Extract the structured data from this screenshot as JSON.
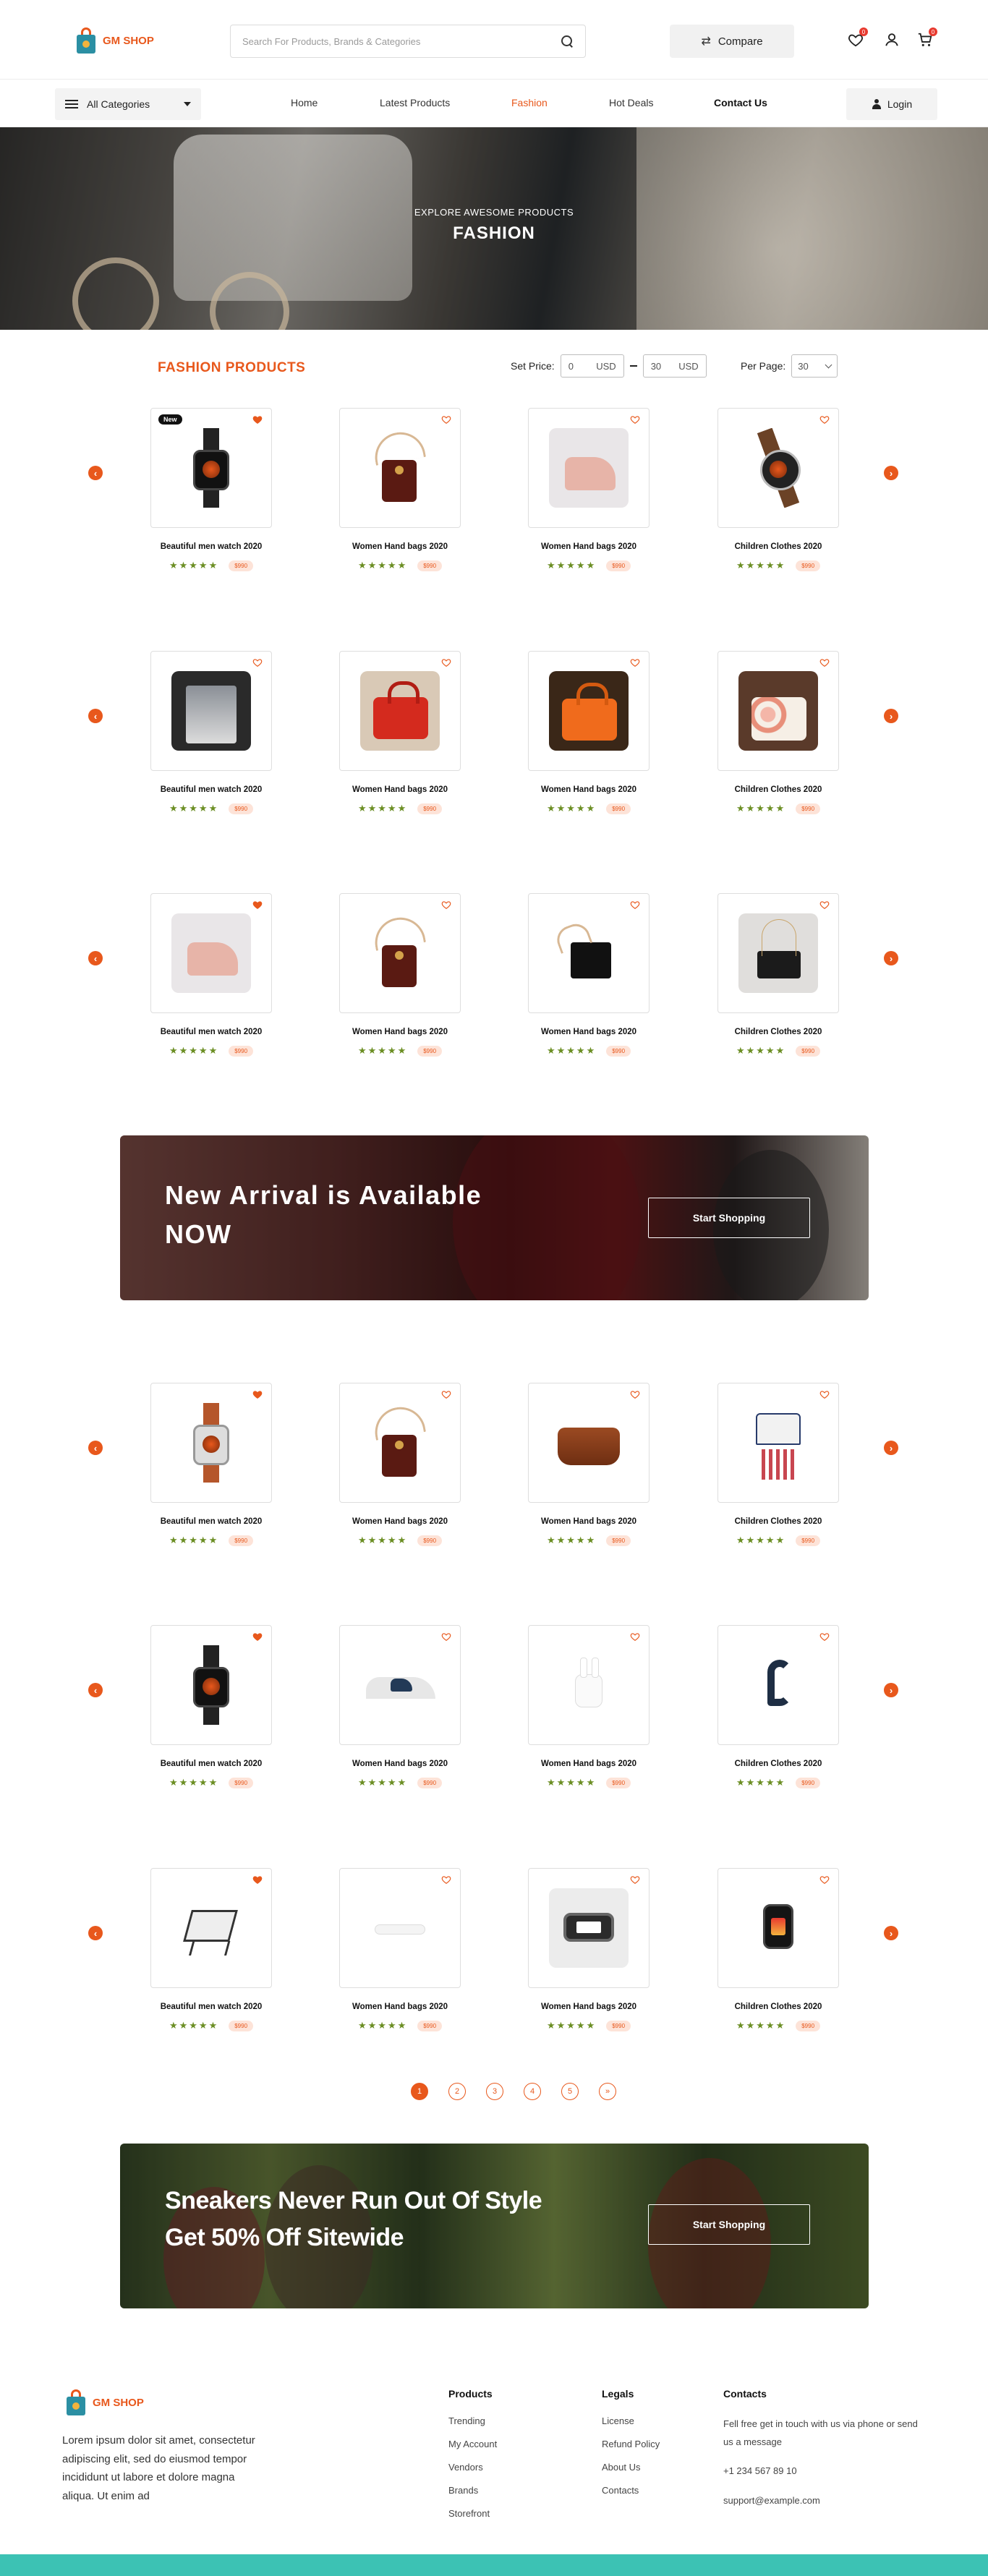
{
  "brand": {
    "name": "GM SHOP",
    "accent": "#e8581c"
  },
  "header": {
    "search_placeholder": "Search For Products, Brands & Categories",
    "compare_label": "Compare",
    "wishlist_badge": "0",
    "cart_badge": "0"
  },
  "nav": {
    "category_label": "All Categories",
    "links": [
      "Home",
      "Latest Products",
      "Fashion",
      "Hot Deals",
      "Contact Us"
    ],
    "active": "Fashion",
    "login_label": "Login"
  },
  "hero": {
    "kicker": "EXPLORE AWESOME PRODUCTS",
    "title": "FASHION"
  },
  "products_section": {
    "title": "FASHION PRODUCTS",
    "price_label": "Set Price:",
    "price_min": "0",
    "price_max": "30",
    "currency": "USD",
    "per_page_label": "Per Page:",
    "per_page_value": "30"
  },
  "product_rows": [
    [
      {
        "name": "Beautiful men watch 2020",
        "price": "$990",
        "img": "watch",
        "new": "New",
        "fav": true
      },
      {
        "name": "Women Hand bags 2020",
        "price": "$990",
        "img": "sling",
        "fav": false
      },
      {
        "name": "Women Hand bags 2020",
        "price": "$990",
        "img": "pink",
        "fav": false
      },
      {
        "name": "Children Clothes 2020",
        "price": "$990",
        "img": "watch round",
        "fav": false
      }
    ],
    [
      {
        "name": "Beautiful men watch 2020",
        "price": "$990",
        "img": "dark",
        "fav": false
      },
      {
        "name": "Women Hand bags 2020",
        "price": "$990",
        "img": "red",
        "fav": false
      },
      {
        "name": "Women Hand bags 2020",
        "price": "$990",
        "img": "orange",
        "fav": false
      },
      {
        "name": "Children Clothes 2020",
        "price": "$990",
        "img": "floral",
        "fav": false
      }
    ],
    [
      {
        "name": "Beautiful men watch 2020",
        "price": "$990",
        "img": "pink",
        "fav": true
      },
      {
        "name": "Women Hand bags 2020",
        "price": "$990",
        "img": "sling",
        "fav": false
      },
      {
        "name": "Women Hand bags 2020",
        "price": "$990",
        "img": "tote",
        "fav": false
      },
      {
        "name": "Children Clothes 2020",
        "price": "$990",
        "img": "clutch",
        "fav": false
      }
    ],
    [
      {
        "name": "Beautiful men watch 2020",
        "price": "$990",
        "img": "watch brown",
        "fav": true
      },
      {
        "name": "Women Hand bags 2020",
        "price": "$990",
        "img": "sling",
        "fav": false
      },
      {
        "name": "Women Hand bags 2020",
        "price": "$990",
        "img": "leather",
        "fav": false
      },
      {
        "name": "Children Clothes 2020",
        "price": "$990",
        "img": "kids",
        "fav": false
      }
    ],
    [
      {
        "name": "Beautiful men watch 2020",
        "price": "$990",
        "img": "watch",
        "fav": true
      },
      {
        "name": "Women Hand bags 2020",
        "price": "$990",
        "img": "shoe",
        "fav": false
      },
      {
        "name": "Women Hand bags 2020",
        "price": "$990",
        "img": "pods",
        "fav": false
      },
      {
        "name": "Children Clothes 2020",
        "price": "$990",
        "img": "headset",
        "fav": false
      }
    ],
    [
      {
        "name": "Beautiful men watch 2020",
        "price": "$990",
        "img": "stand",
        "fav": true
      },
      {
        "name": "Women Hand bags 2020",
        "price": "$990",
        "img": "cable",
        "fav": false
      },
      {
        "name": "Women Hand bags 2020",
        "price": "$990",
        "img": "band",
        "fav": false
      },
      {
        "name": "Children Clothes 2020",
        "price": "$990",
        "img": "smart",
        "fav": false
      }
    ]
  ],
  "rating_stars": "★★★★★",
  "banner1": {
    "title_line1": "New Arrival is Available",
    "title_line2": "NOW",
    "button": "Start Shopping"
  },
  "banner2": {
    "title_line1": "Sneakers Never Run Out Of Style",
    "title_line2": "Get 50% Off Sitewide",
    "button": "Start Shopping"
  },
  "pagination": {
    "pages": [
      "1",
      "2",
      "3",
      "4",
      "5",
      "»"
    ],
    "current": "1"
  },
  "footer": {
    "about": "Lorem ipsum dolor sit amet, consectetur adipiscing elit, sed do eiusmod tempor incididunt ut labore et dolore magna aliqua. Ut enim ad",
    "products": {
      "title": "Products",
      "links": [
        "Trending",
        "My Account",
        "Vendors",
        "Brands",
        "Storefront"
      ]
    },
    "legals": {
      "title": "Legals",
      "links": [
        "License",
        "Refund Policy",
        "About Us",
        "Contacts"
      ]
    },
    "contacts": {
      "title": "Contacts",
      "text": "Fell free get in touch with us via phone or send us a message",
      "phone": "+1 234 567 89 10",
      "email": "support@example.com"
    }
  },
  "colors": {
    "accent": "#e8581c",
    "star": "#6b8e23",
    "price_bg": "#fde3d8",
    "footer_strip": "#3cc2b4"
  }
}
